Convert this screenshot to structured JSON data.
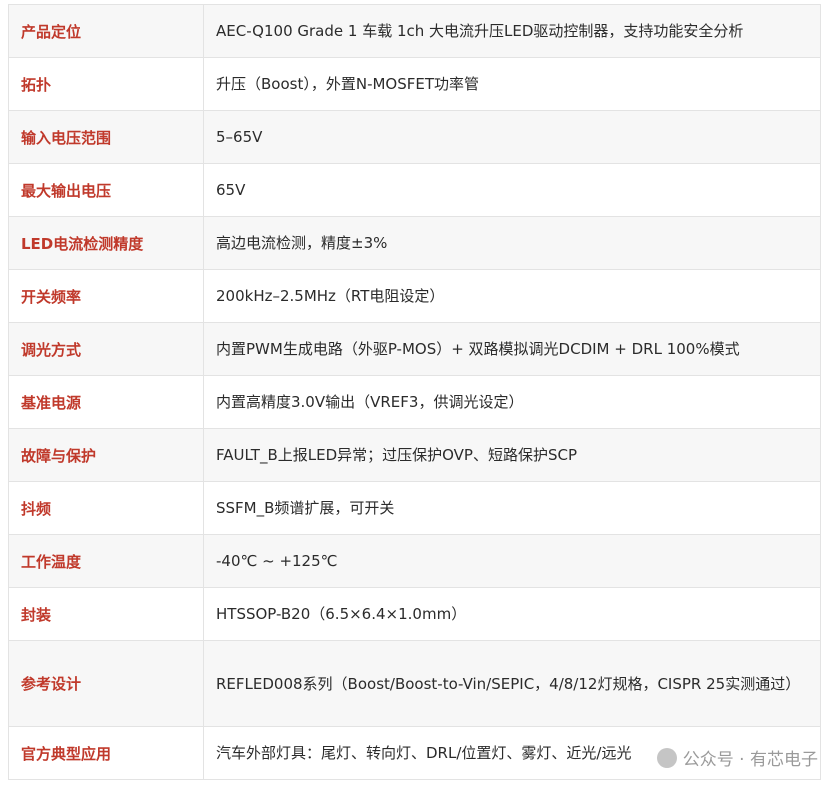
{
  "rows": [
    {
      "label": "产品定位",
      "value": "AEC-Q100 Grade 1 车载 1ch 大电流升压LED驱动控制器，支持功能安全分析"
    },
    {
      "label": "拓扑",
      "value": "升压（Boost），外置N-MOSFET功率管"
    },
    {
      "label": "输入电压范围",
      "value": "5–65V"
    },
    {
      "label": "最大输出电压",
      "value": "65V"
    },
    {
      "label": "LED电流检测精度",
      "value": "高边电流检测，精度±3%"
    },
    {
      "label": "开关频率",
      "value": "200kHz–2.5MHz（RT电阻设定）"
    },
    {
      "label": "调光方式",
      "value": "内置PWM生成电路（外驱P-MOS）+ 双路模拟调光DCDIM + DRL 100%模式"
    },
    {
      "label": "基准电源",
      "value": "内置高精度3.0V输出（VREF3，供调光设定）"
    },
    {
      "label": "故障与保护",
      "value": "FAULT_B上报LED异常；过压保护OVP、短路保护SCP"
    },
    {
      "label": "抖频",
      "value": "SSFM_B频谱扩展，可开关"
    },
    {
      "label": "工作温度",
      "value": "-40℃ ~ +125℃"
    },
    {
      "label": "封装",
      "value": "HTSSOP-B20（6.5×6.4×1.0mm）"
    },
    {
      "label": "参考设计",
      "value": "REFLED008系列（Boost/Boost-to-Vin/SEPIC，4/8/12灯规格，CISPR 25实测通过）"
    },
    {
      "label": "官方典型应用",
      "value": "汽车外部灯具：尾灯、转向灯、DRL/位置灯、雾灯、近光/远光"
    }
  ],
  "watermark": {
    "text": "公众号 · 有芯电子",
    "icon": "wechat-icon"
  },
  "colors": {
    "label": "#c0392b",
    "text": "#2b2b2b",
    "border": "#e3e3e3",
    "stripe": "#f7f7f7"
  }
}
